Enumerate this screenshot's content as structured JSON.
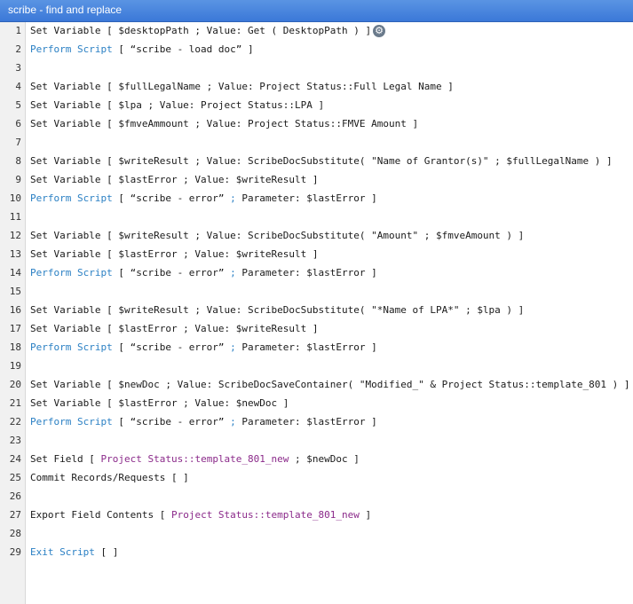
{
  "window": {
    "title": "scribe - find and replace"
  },
  "lines": [
    {
      "n": "1",
      "parts": [
        {
          "t": "Set Variable [ $desktopPath ; Value: Get ( DesktopPath ) ]",
          "c": ""
        }
      ],
      "gear": true
    },
    {
      "n": "2",
      "parts": [
        {
          "t": "Perform Script",
          "c": "blue"
        },
        {
          "t": " [ “scribe - load doc” ]",
          "c": ""
        }
      ]
    },
    {
      "n": "3",
      "parts": []
    },
    {
      "n": "4",
      "parts": [
        {
          "t": "Set Variable [ $fullLegalName ; Value: Project Status::Full Legal Name ]",
          "c": ""
        }
      ]
    },
    {
      "n": "5",
      "parts": [
        {
          "t": "Set Variable [ $lpa ; Value: Project Status::LPA ]",
          "c": ""
        }
      ]
    },
    {
      "n": "6",
      "parts": [
        {
          "t": "Set Variable [ $fmveAmmount ; Value: Project Status::FMVE Amount ]",
          "c": ""
        }
      ]
    },
    {
      "n": "7",
      "parts": []
    },
    {
      "n": "8",
      "parts": [
        {
          "t": "Set Variable [ $writeResult ; Value: ScribeDocSubstitute( \"Name of Grantor(s)\" ; $fullLegalName ) ]",
          "c": ""
        }
      ]
    },
    {
      "n": "9",
      "parts": [
        {
          "t": "Set Variable [ $lastError ; Value: $writeResult ]",
          "c": ""
        }
      ]
    },
    {
      "n": "10",
      "parts": [
        {
          "t": "Perform Script",
          "c": "blue"
        },
        {
          "t": " [ “scribe - error” ",
          "c": ""
        },
        {
          "t": ";",
          "c": "blue"
        },
        {
          "t": " Parameter: $lastError ]",
          "c": ""
        }
      ]
    },
    {
      "n": "11",
      "parts": []
    },
    {
      "n": "12",
      "parts": [
        {
          "t": "Set Variable [ $writeResult ; Value: ScribeDocSubstitute( \"Amount\" ; $fmveAmount ) ]",
          "c": ""
        }
      ]
    },
    {
      "n": "13",
      "parts": [
        {
          "t": "Set Variable [ $lastError ; Value: $writeResult ]",
          "c": ""
        }
      ]
    },
    {
      "n": "14",
      "parts": [
        {
          "t": "Perform Script",
          "c": "blue"
        },
        {
          "t": " [ “scribe - error” ",
          "c": ""
        },
        {
          "t": ";",
          "c": "blue"
        },
        {
          "t": " Parameter: $lastError ]",
          "c": ""
        }
      ]
    },
    {
      "n": "15",
      "parts": []
    },
    {
      "n": "16",
      "parts": [
        {
          "t": "Set Variable [ $writeResult ; Value: ScribeDocSubstitute( \"*Name of LPA*\" ; $lpa ) ]",
          "c": ""
        }
      ]
    },
    {
      "n": "17",
      "parts": [
        {
          "t": "Set Variable [ $lastError ; Value: $writeResult ]",
          "c": ""
        }
      ]
    },
    {
      "n": "18",
      "parts": [
        {
          "t": "Perform Script",
          "c": "blue"
        },
        {
          "t": " [ “scribe - error” ",
          "c": ""
        },
        {
          "t": ";",
          "c": "blue"
        },
        {
          "t": " Parameter: $lastError ]",
          "c": ""
        }
      ]
    },
    {
      "n": "19",
      "parts": []
    },
    {
      "n": "20",
      "parts": [
        {
          "t": "Set Variable [ $newDoc ; Value: ScribeDocSaveContainer( \"Modified_\" & Project Status::template_801 ) ]",
          "c": ""
        }
      ]
    },
    {
      "n": "21",
      "parts": [
        {
          "t": "Set Variable [ $lastError ; Value: $newDoc ]",
          "c": ""
        }
      ]
    },
    {
      "n": "22",
      "parts": [
        {
          "t": "Perform Script",
          "c": "blue"
        },
        {
          "t": " [ “scribe - error” ",
          "c": ""
        },
        {
          "t": ";",
          "c": "blue"
        },
        {
          "t": " Parameter: $lastError ]",
          "c": ""
        }
      ]
    },
    {
      "n": "23",
      "parts": []
    },
    {
      "n": "24",
      "parts": [
        {
          "t": "Set Field [ ",
          "c": ""
        },
        {
          "t": "Project Status::template_801_new",
          "c": "purple"
        },
        {
          "t": " ; $newDoc ]",
          "c": ""
        }
      ]
    },
    {
      "n": "25",
      "parts": [
        {
          "t": "Commit Records/Requests [ ]",
          "c": ""
        }
      ]
    },
    {
      "n": "26",
      "parts": []
    },
    {
      "n": "27",
      "parts": [
        {
          "t": "Export Field Contents [ ",
          "c": ""
        },
        {
          "t": "Project Status::template_801_new",
          "c": "purple"
        },
        {
          "t": " ]",
          "c": ""
        }
      ]
    },
    {
      "n": "28",
      "parts": []
    },
    {
      "n": "29",
      "parts": [
        {
          "t": "Exit Script",
          "c": "blue"
        },
        {
          "t": " [ ]",
          "c": ""
        }
      ]
    }
  ]
}
